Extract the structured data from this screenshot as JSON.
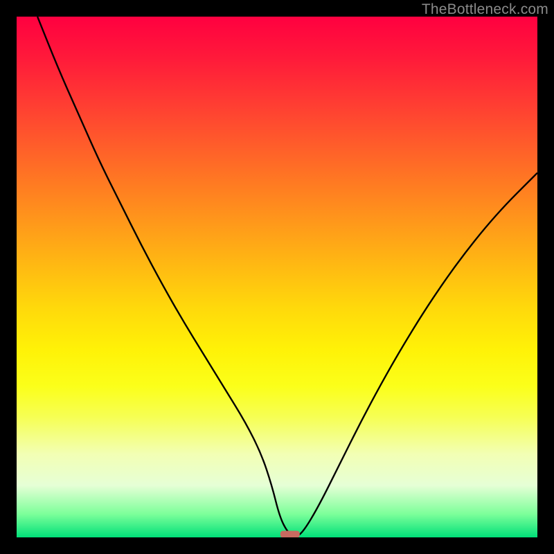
{
  "watermark": "TheBottleneck.com",
  "chart_data": {
    "type": "line",
    "title": "",
    "xlabel": "",
    "ylabel": "",
    "xlim": [
      0,
      100
    ],
    "ylim": [
      0,
      100
    ],
    "grid": false,
    "legend": false,
    "series": [
      {
        "name": "curve",
        "x": [
          4,
          8,
          12,
          16,
          20,
          24,
          28,
          32,
          36,
          40,
          44,
          47,
          49,
          50.5,
          52,
          53.5,
          55,
          58,
          62,
          66,
          70,
          74,
          78,
          82,
          86,
          90,
          94,
          98,
          100
        ],
        "y": [
          100,
          90,
          81,
          72,
          64,
          56,
          48.5,
          41.5,
          35,
          28.5,
          22,
          16,
          10,
          4,
          1,
          0,
          1,
          6,
          14,
          22,
          29.5,
          36.5,
          43,
          49,
          54.5,
          59.5,
          64,
          68,
          70
        ]
      }
    ],
    "marker": {
      "x": 52.5,
      "y": 0.6,
      "color": "#c86a60"
    },
    "background_gradient": {
      "direction": "vertical",
      "stops": [
        {
          "pos": 0.0,
          "color": "#ff0040"
        },
        {
          "pos": 0.35,
          "color": "#ff8a1e"
        },
        {
          "pos": 0.65,
          "color": "#fff207"
        },
        {
          "pos": 0.88,
          "color": "#f2ffb4"
        },
        {
          "pos": 1.0,
          "color": "#00e079"
        }
      ]
    }
  }
}
